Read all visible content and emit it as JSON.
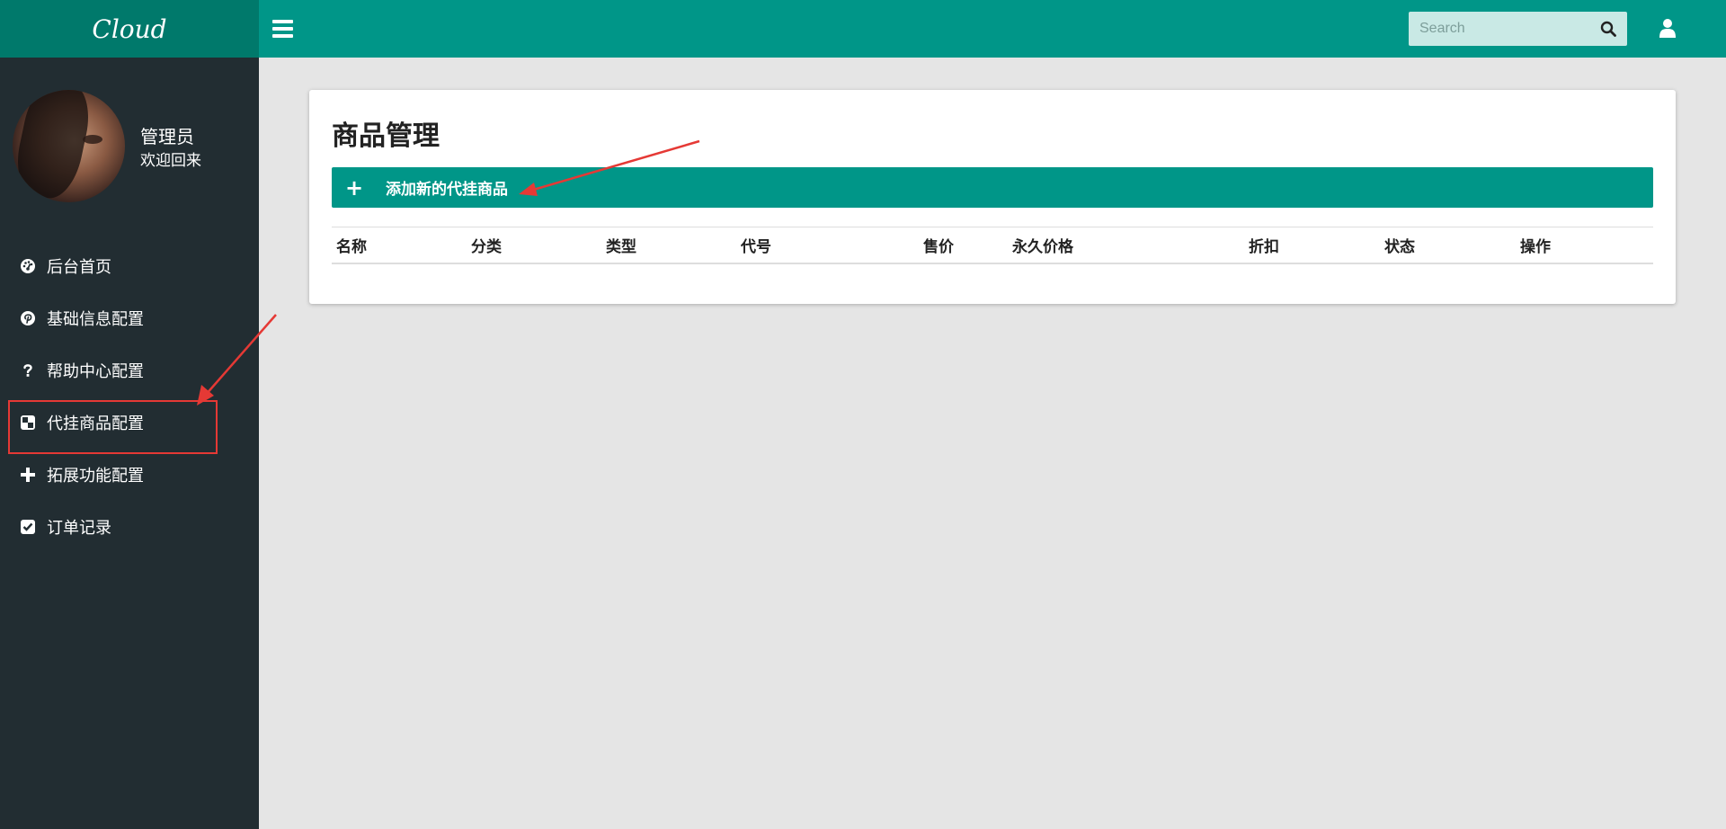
{
  "header": {
    "logo": "Cloud",
    "search_placeholder": "Search"
  },
  "profile": {
    "name": "管理员",
    "status": "欢迎回来"
  },
  "sidebar": {
    "items": [
      {
        "label": "后台首页",
        "icon": "dashboard-icon"
      },
      {
        "label": "基础信息配置",
        "icon": "pinterest-icon"
      },
      {
        "label": "帮助中心配置",
        "icon": "question-icon"
      },
      {
        "label": "代挂商品配置",
        "icon": "checkerboard-icon"
      },
      {
        "label": "拓展功能配置",
        "icon": "plus-icon"
      },
      {
        "label": "订单记录",
        "icon": "checkbox-icon"
      }
    ]
  },
  "main": {
    "title": "商品管理",
    "add_button": {
      "icon": "+",
      "label": "添加新的代挂商品"
    },
    "table": {
      "columns": [
        "名称",
        "分类",
        "类型",
        "代号",
        "售价",
        "永久价格",
        "折扣",
        "状态",
        "操作"
      ],
      "rows": []
    }
  },
  "colors": {
    "primary": "#009688",
    "primary_dark": "#00796b",
    "sidebar_bg": "#222d32",
    "page_bg": "#e5e5e5",
    "annotation": "#e53935"
  }
}
